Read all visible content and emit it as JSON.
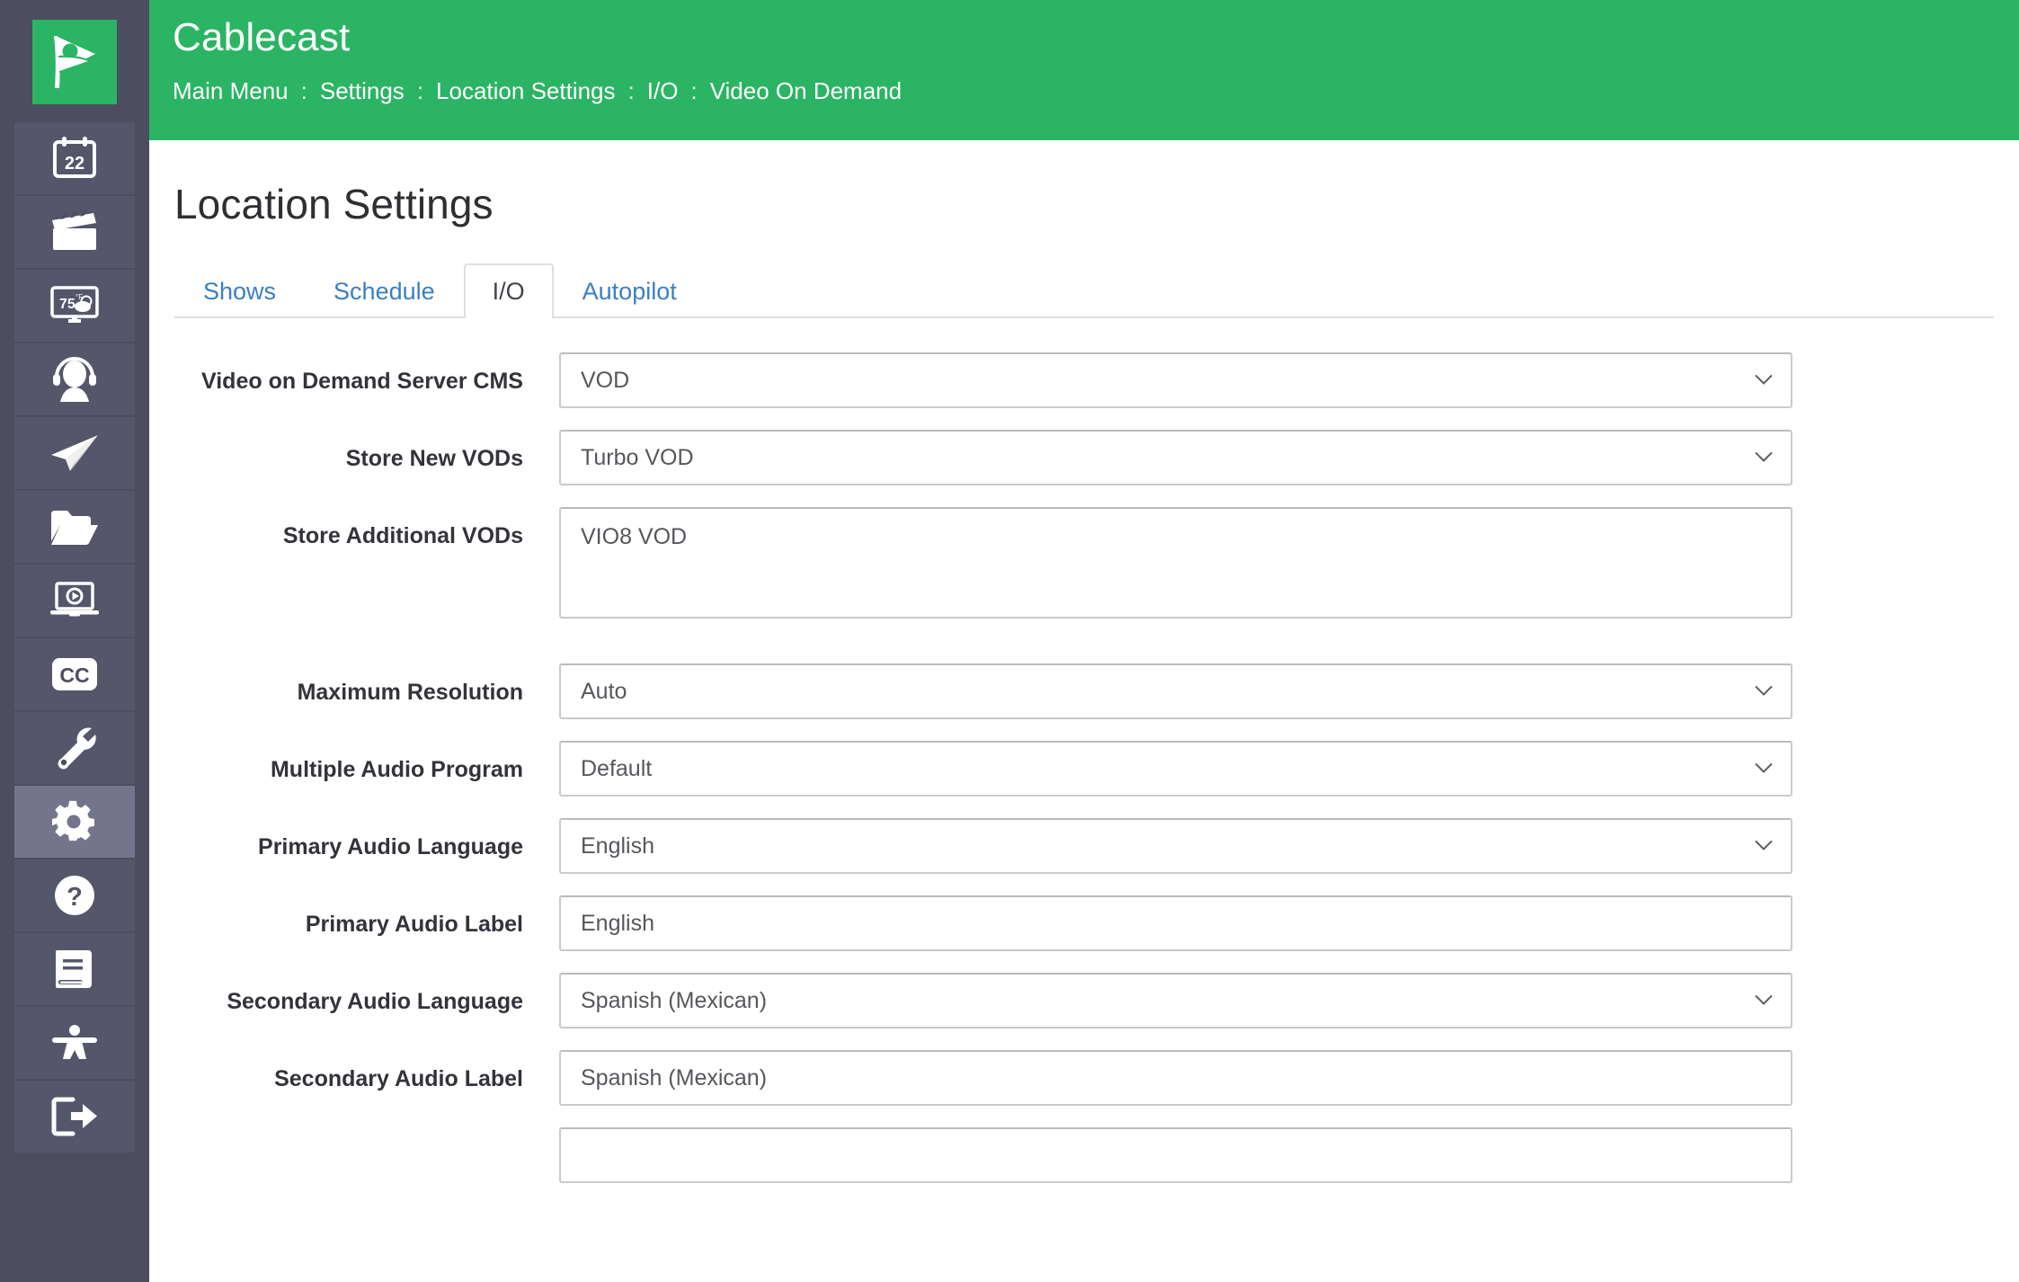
{
  "brand": {
    "name": "Cablecast",
    "logo_icon": "cablecast-flag-play-logo",
    "green": "#2bb464",
    "sidebar_bg": "#4c4d5e",
    "link_blue": "#3b7fc4"
  },
  "breadcrumb": {
    "separator": ":",
    "items": [
      "Main Menu",
      "Settings",
      "Location Settings",
      "I/O",
      "Video On Demand"
    ]
  },
  "sidebar": {
    "items": [
      {
        "name": "schedule",
        "icon": "calendar-22-icon",
        "label": "Schedule",
        "active": false
      },
      {
        "name": "shows",
        "icon": "clapperboard-icon",
        "label": "Shows",
        "active": false
      },
      {
        "name": "bulletin-board",
        "icon": "monitor-weather-75-icon",
        "label": "Bulletin Board",
        "active": false,
        "temperature": "75",
        "unit": "°F"
      },
      {
        "name": "live-assist",
        "icon": "headset-operator-icon",
        "label": "Live Assist",
        "active": false
      },
      {
        "name": "digital-file-delivery",
        "icon": "paper-plane-icon",
        "label": "Digital File Delivery",
        "active": false
      },
      {
        "name": "file-manager",
        "icon": "open-folder-icon",
        "label": "File Manager",
        "active": false
      },
      {
        "name": "vod-player",
        "icon": "laptop-play-icon",
        "label": "Video On Demand",
        "active": false
      },
      {
        "name": "closed-captioning",
        "icon": "cc-icon",
        "label": "Closed Captioning",
        "active": false
      },
      {
        "name": "tools",
        "icon": "wrench-icon",
        "label": "Tools",
        "active": false
      },
      {
        "name": "settings",
        "icon": "gear-icon",
        "label": "Settings",
        "active": true
      },
      {
        "name": "help",
        "icon": "question-circle-icon",
        "label": "Help",
        "active": false
      },
      {
        "name": "docs",
        "icon": "book-icon",
        "label": "Documentation",
        "active": false
      },
      {
        "name": "accessibility",
        "icon": "person-arms-out-icon",
        "label": "Accessibility",
        "active": false
      },
      {
        "name": "logout",
        "icon": "logout-arrow-icon",
        "label": "Log Out",
        "active": false
      }
    ]
  },
  "page": {
    "title": "Location Settings"
  },
  "tabs": [
    {
      "label": "Shows",
      "active": false
    },
    {
      "label": "Schedule",
      "active": false
    },
    {
      "label": "I/O",
      "active": true
    },
    {
      "label": "Autopilot",
      "active": false
    }
  ],
  "form": {
    "fields": [
      {
        "name": "video-on-demand-server-cms",
        "label": "Video on Demand Server CMS",
        "type": "select",
        "value": "VOD"
      },
      {
        "name": "store-new-vods",
        "label": "Store New VODs",
        "type": "select",
        "value": "Turbo VOD"
      },
      {
        "name": "store-additional-vods",
        "label": "Store Additional VODs",
        "type": "multiselect",
        "options": [
          "VIO8 VOD"
        ]
      },
      {
        "name": "maximum-resolution",
        "label": "Maximum Resolution",
        "type": "select",
        "value": "Auto"
      },
      {
        "name": "multiple-audio-program",
        "label": "Multiple Audio Program",
        "type": "select",
        "value": "Default"
      },
      {
        "name": "primary-audio-language",
        "label": "Primary Audio Language",
        "type": "select",
        "value": "English"
      },
      {
        "name": "primary-audio-label",
        "label": "Primary Audio Label",
        "type": "text",
        "value": "English"
      },
      {
        "name": "secondary-audio-language",
        "label": "Secondary Audio Language",
        "type": "select",
        "value": "Spanish (Mexican)"
      },
      {
        "name": "secondary-audio-label",
        "label": "Secondary Audio Label",
        "type": "text",
        "value": "Spanish (Mexican)"
      }
    ]
  }
}
